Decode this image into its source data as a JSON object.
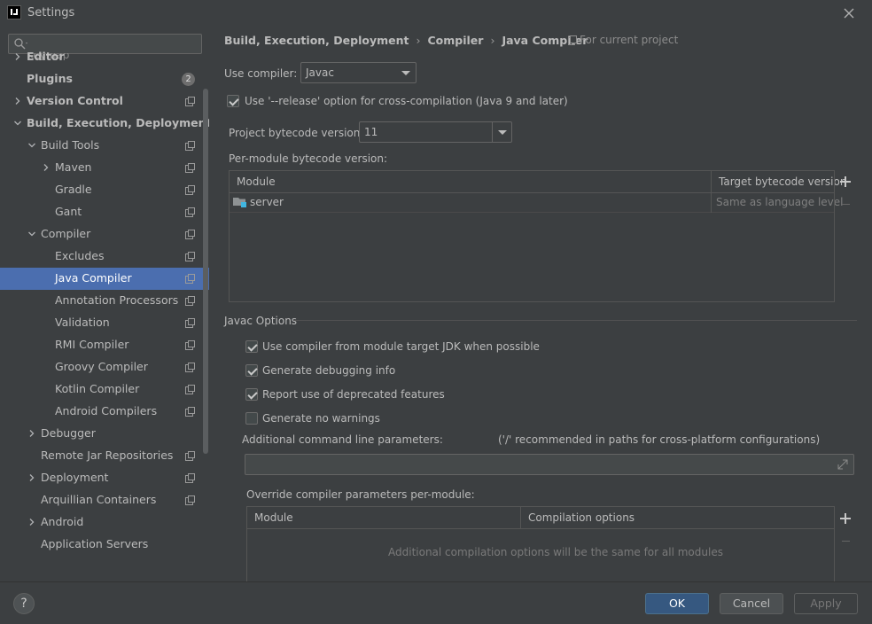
{
  "window": {
    "title": "Settings"
  },
  "search": {
    "placeholder": ""
  },
  "sidebar": {
    "partial_top": "Keymap",
    "items": [
      {
        "label": "Editor",
        "expander": "collapsed"
      },
      {
        "label": "Plugins",
        "badge": "2"
      },
      {
        "label": "Version Control",
        "expander": "collapsed"
      },
      {
        "label": "Build, Execution, Deployment",
        "expander": "expanded"
      },
      {
        "label": "Build Tools",
        "expander": "expanded"
      },
      {
        "label": "Maven",
        "expander": "collapsed"
      },
      {
        "label": "Gradle"
      },
      {
        "label": "Gant"
      },
      {
        "label": "Compiler",
        "expander": "expanded"
      },
      {
        "label": "Excludes"
      },
      {
        "label": "Java Compiler",
        "selected": true
      },
      {
        "label": "Annotation Processors"
      },
      {
        "label": "Validation"
      },
      {
        "label": "RMI Compiler"
      },
      {
        "label": "Groovy Compiler"
      },
      {
        "label": "Kotlin Compiler"
      },
      {
        "label": "Android Compilers"
      },
      {
        "label": "Debugger",
        "expander": "collapsed"
      },
      {
        "label": "Remote Jar Repositories"
      },
      {
        "label": "Deployment",
        "expander": "collapsed"
      },
      {
        "label": "Arquillian Containers"
      },
      {
        "label": "Android",
        "expander": "collapsed"
      },
      {
        "label": "Application Servers"
      }
    ]
  },
  "breadcrumb": {
    "items": [
      "Build, Execution, Deployment",
      "Compiler",
      "Java Compiler"
    ],
    "separator": "›",
    "scope_note": "For current project"
  },
  "compiler": {
    "use_compiler_label": "Use compiler:",
    "use_compiler_value": "Javac",
    "release_option_label": "Use '--release' option for cross-compilation (Java 9 and later)",
    "release_option_checked": true,
    "bytecode_label": "Project bytecode version:",
    "bytecode_value": "11",
    "per_module_label": "Per-module bytecode version:",
    "module_table": {
      "columns": [
        "Module",
        "Target bytecode version"
      ],
      "rows": [
        {
          "module": "server",
          "target": "Same as language level"
        }
      ]
    }
  },
  "javac_options": {
    "section_title": "Javac Options",
    "checkboxes": [
      {
        "label": "Use compiler from module target JDK when possible",
        "checked": true
      },
      {
        "label": "Generate debugging info",
        "checked": true
      },
      {
        "label": "Report use of deprecated features",
        "checked": true
      },
      {
        "label": "Generate no warnings",
        "checked": false
      }
    ],
    "additional_params_label": "Additional command line parameters:",
    "additional_params_hint": "('/' recommended in paths for cross-platform configurations)",
    "additional_params_value": "",
    "override_label": "Override compiler parameters per-module:",
    "override_table": {
      "columns": [
        "Module",
        "Compilation options"
      ],
      "empty_text": "Additional compilation options will be the same for all modules"
    }
  },
  "footer": {
    "help": "?",
    "ok": "OK",
    "cancel": "Cancel",
    "apply": "Apply"
  }
}
